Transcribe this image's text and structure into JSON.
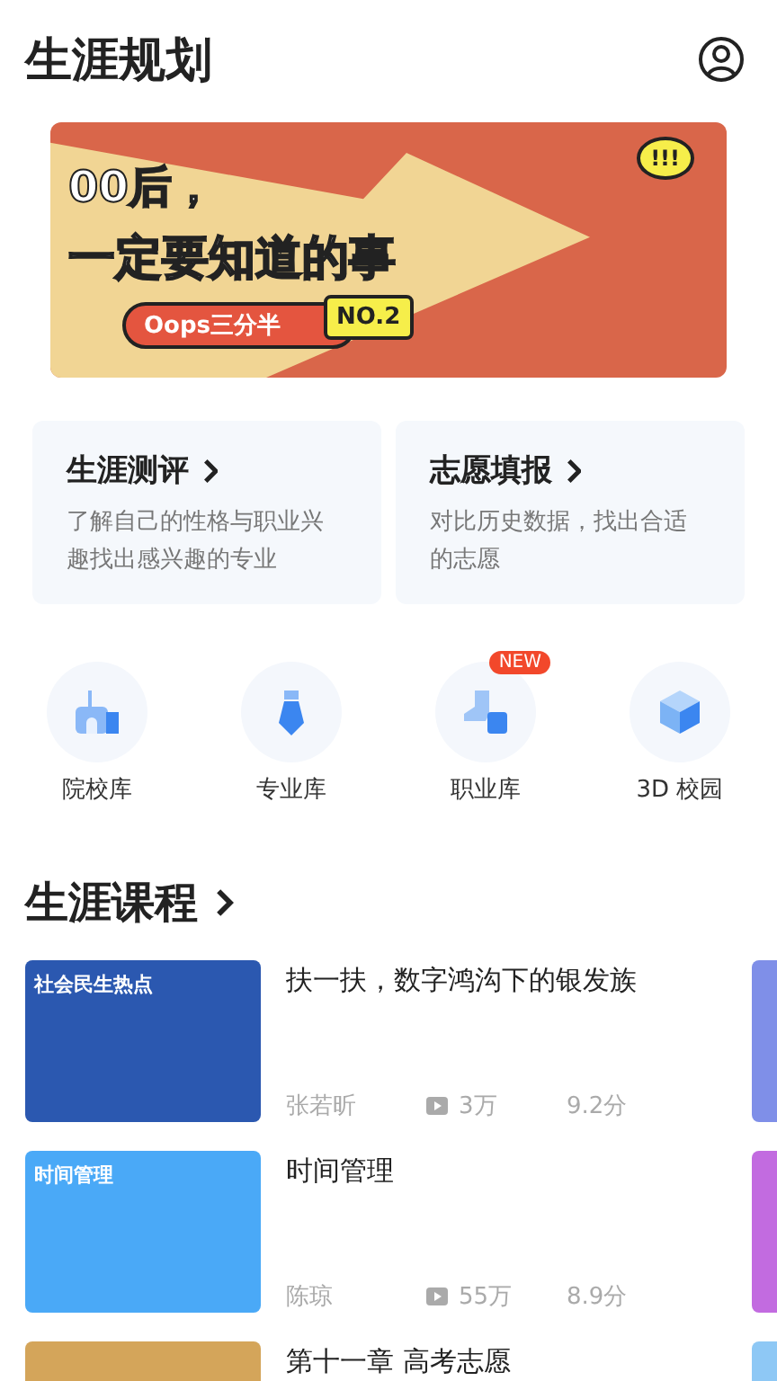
{
  "header": {
    "title": "生涯规划"
  },
  "banner": {
    "headline_1": "00后，",
    "headline_2": "一定要知道的事",
    "tag": "Oops三分半",
    "badge": "NO.2",
    "burst": "!!!"
  },
  "feature_cards": [
    {
      "title": "生涯测评",
      "description": "了解自己的性格与职业兴趣找出感兴趣的专业"
    },
    {
      "title": "志愿填报",
      "description": "对比历史数据，找出合适的志愿"
    }
  ],
  "shortcuts": [
    {
      "kind": "school",
      "label": "院校库"
    },
    {
      "kind": "major",
      "label": "专业库"
    },
    {
      "kind": "career",
      "label": "职业库",
      "badge": "NEW"
    },
    {
      "kind": "campus",
      "label": "3D 校园"
    }
  ],
  "section": {
    "title": "生涯课程"
  },
  "courses": [
    {
      "kind": "elder",
      "cover_label": "社会民生热点",
      "title": "扶一扶，数字鸿沟下的银发族",
      "teacher": "张若昕",
      "views": "3万",
      "score": "9.2分"
    },
    {
      "kind": "time",
      "cover_label": "时间管理",
      "title": "时间管理",
      "teacher": "陈琼",
      "views": "55万",
      "score": "8.9分"
    },
    {
      "kind": "gold",
      "title": "第十一章 高考志愿"
    }
  ]
}
